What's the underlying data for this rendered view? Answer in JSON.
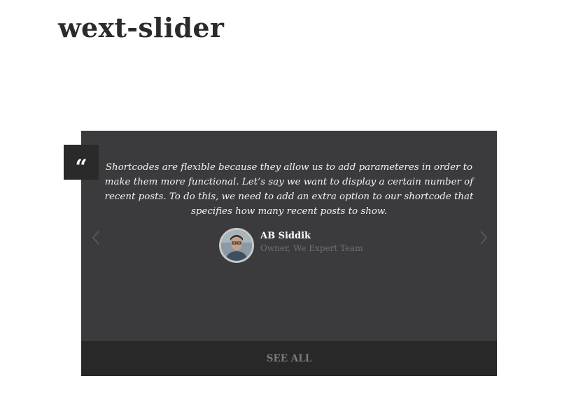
{
  "page": {
    "title": "wext-slider"
  },
  "slider": {
    "quote_badge": "“",
    "testimonial": {
      "quote": "Shortcodes are flexible because they allow us to add parameteres in order to make them more functional. Let’s say we want to display a certain number of recent posts. To do this, we need to add an extra option to our shortcode that specifies how many recent posts to show.",
      "author_name": "AB Siddik",
      "author_role": "Owner, We Expert Team"
    },
    "prev_icon": "chevron-left-icon",
    "next_icon": "chevron-right-icon",
    "see_all_label": "SEE ALL"
  },
  "colors": {
    "slider_background": "#3b3b3d",
    "footer_background": "#282829",
    "badge_background": "#2a2a2a"
  }
}
